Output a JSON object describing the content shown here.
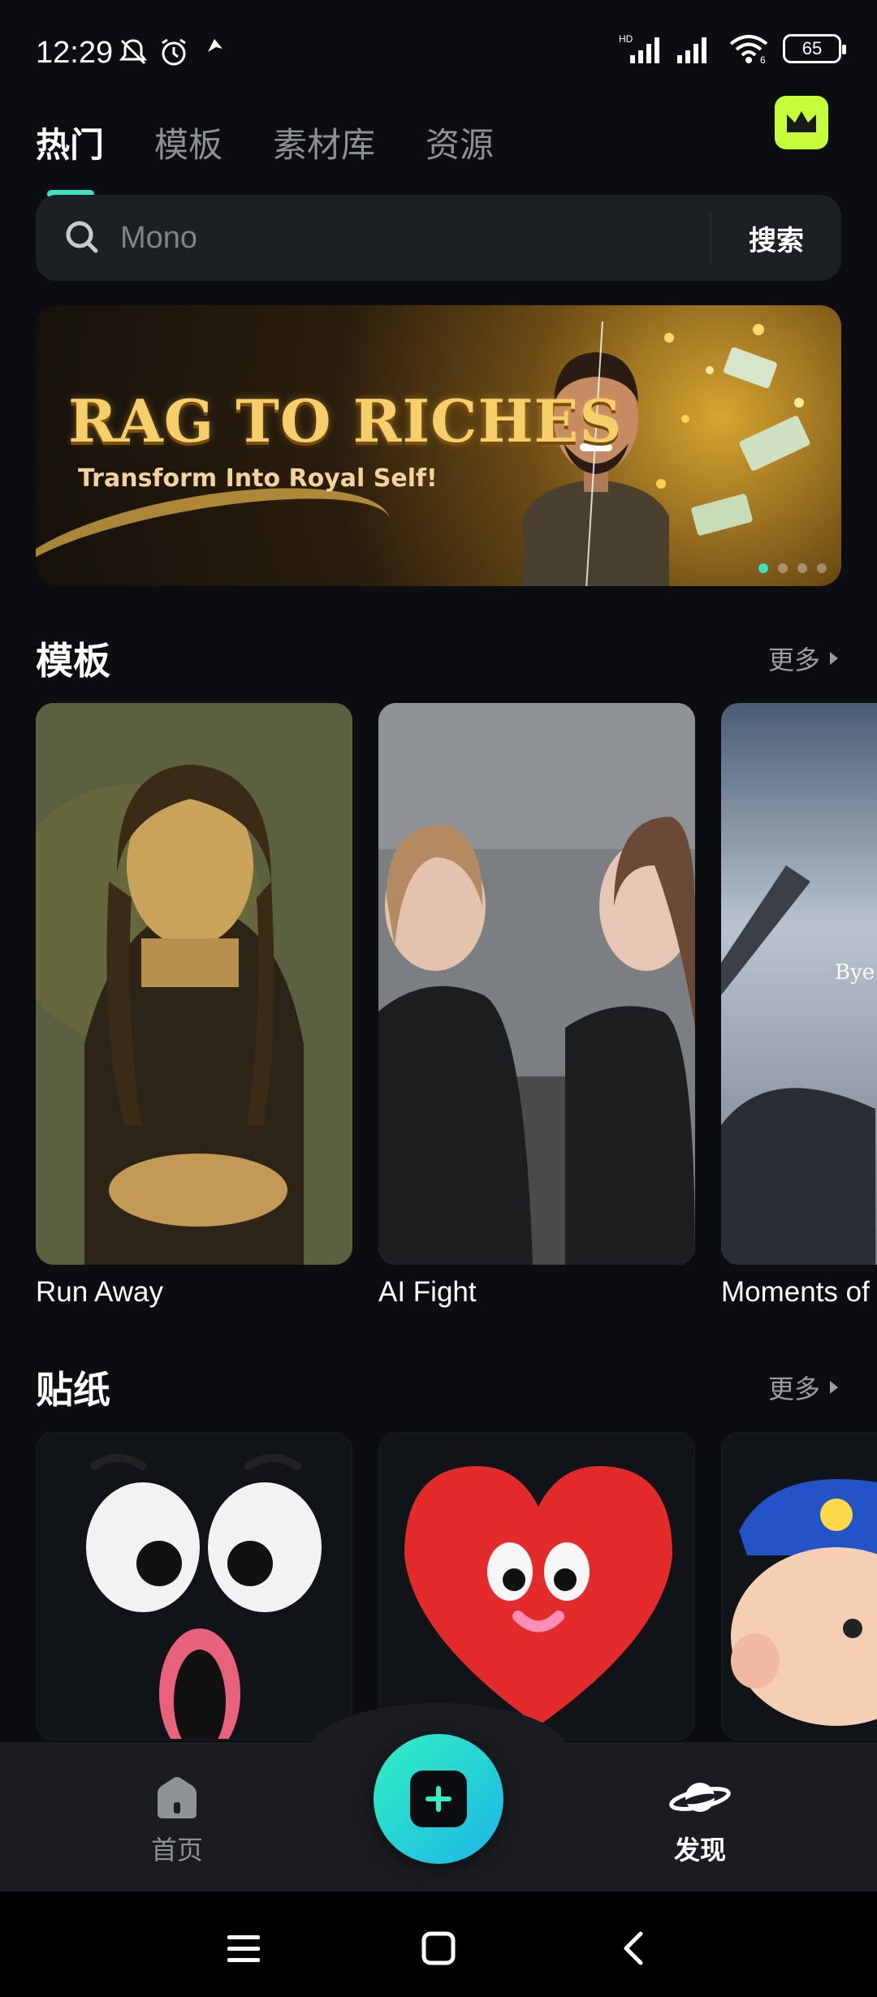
{
  "status_bar": {
    "time": "12:29",
    "battery": "65",
    "network_badge": "HD",
    "wifi_badge": "6"
  },
  "tabs": [
    {
      "label": "热门",
      "active": true
    },
    {
      "label": "模板",
      "active": false
    },
    {
      "label": "素材库",
      "active": false
    },
    {
      "label": "资源",
      "active": false
    }
  ],
  "premium": {
    "icon": "crown-icon",
    "color": "#c6ff3a"
  },
  "search": {
    "placeholder": "Mono",
    "button_label": "搜索"
  },
  "banner": {
    "title": "RAG TO RICHES",
    "subtitle": "Transform Into Royal Self!",
    "dots_count": 4,
    "active_dot": 0
  },
  "templates_section": {
    "title": "模板",
    "more_label": "更多",
    "items": [
      {
        "label": "Run Away"
      },
      {
        "label": "AI Fight"
      },
      {
        "label": "Moments of",
        "overlay_text": "Bye"
      }
    ]
  },
  "stickers_section": {
    "title": "贴纸",
    "more_label": "更多"
  },
  "bottom_nav": {
    "home_label": "首页",
    "discover_label": "发现",
    "create_icon": "plus-icon",
    "active": "discover"
  },
  "colors": {
    "accent": "#3ce3c2",
    "background": "#0b0d10",
    "premium": "#c6ff3a"
  }
}
